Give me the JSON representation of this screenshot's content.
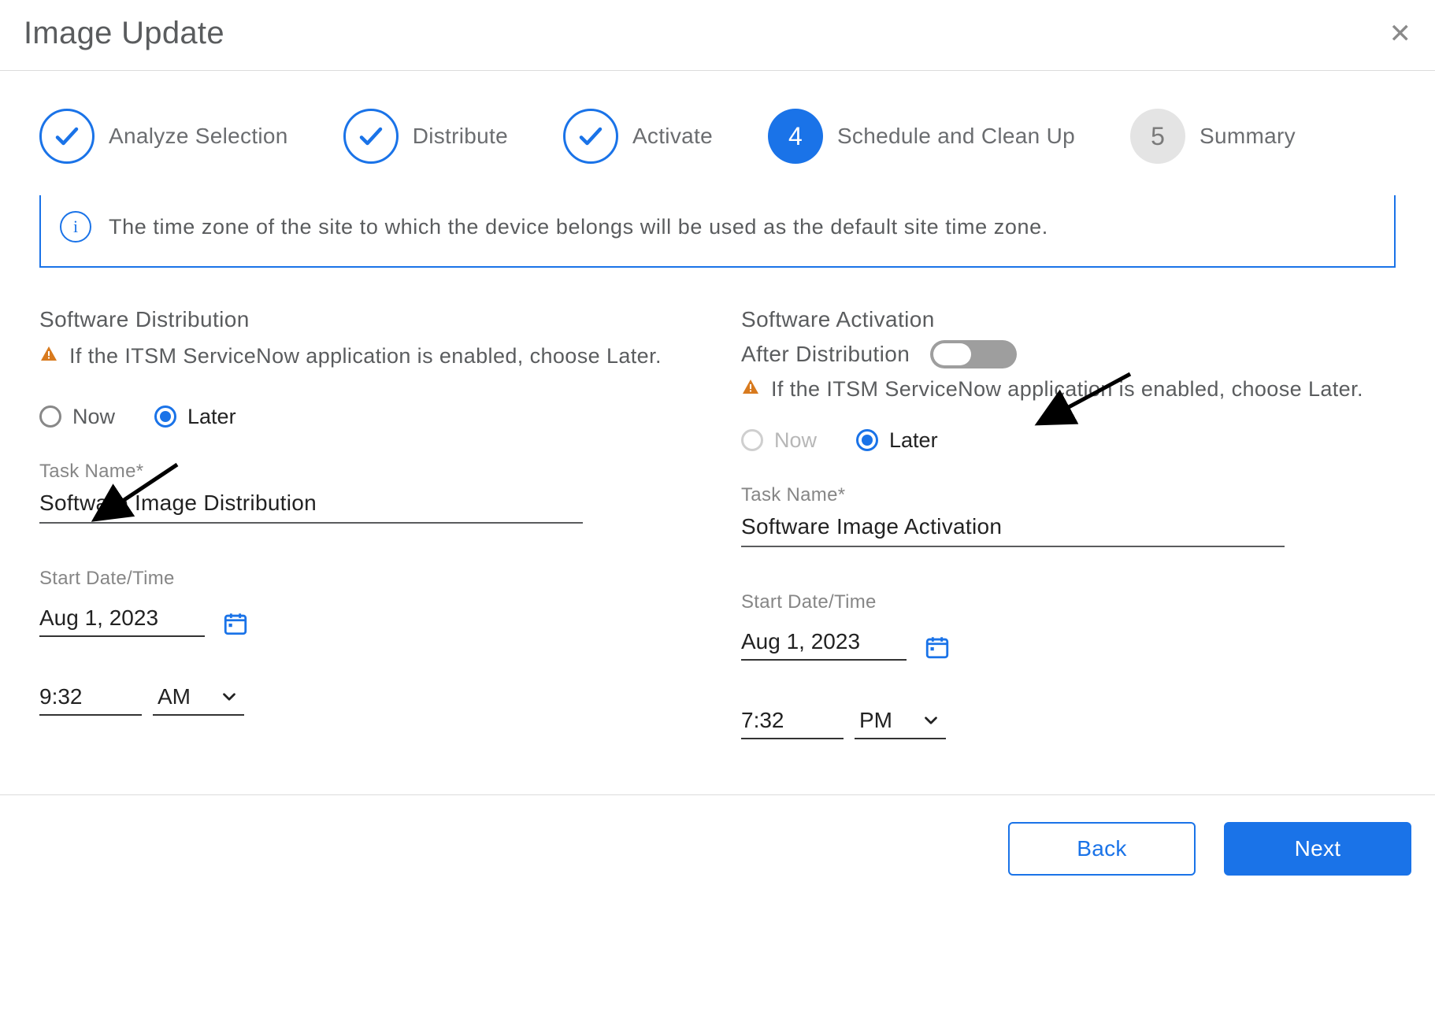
{
  "dialog": {
    "title": "Image Update"
  },
  "stepper": {
    "s1": "Analyze Selection",
    "s2": "Distribute",
    "s3": "Activate",
    "s4_num": "4",
    "s4": "Schedule and Clean Up",
    "s5_num": "5",
    "s5": "Summary"
  },
  "info_banner": "The time zone of the site to which the device belongs will be used as the default site time zone.",
  "distribution": {
    "title": "Software Distribution",
    "warning": "If the ITSM ServiceNow application is enabled, choose Later.",
    "radio_now": "Now",
    "radio_later": "Later",
    "task_label": "Task Name*",
    "task_value": "Software Image Distribution",
    "dt_label": "Start Date/Time",
    "date_value": "Aug 1, 2023",
    "time_value": "9:32",
    "ampm": "AM"
  },
  "activation": {
    "title": "Software Activation",
    "after_dist_label": "After Distribution",
    "toggle_on": false,
    "warning": "If the ITSM ServiceNow application is enabled, choose Later.",
    "radio_now": "Now",
    "radio_later": "Later",
    "task_label": "Task Name*",
    "task_value": "Software Image Activation",
    "dt_label": "Start Date/Time",
    "date_value": "Aug 1, 2023",
    "time_value": "7:32",
    "ampm": "PM"
  },
  "footer": {
    "back": "Back",
    "next": "Next"
  }
}
